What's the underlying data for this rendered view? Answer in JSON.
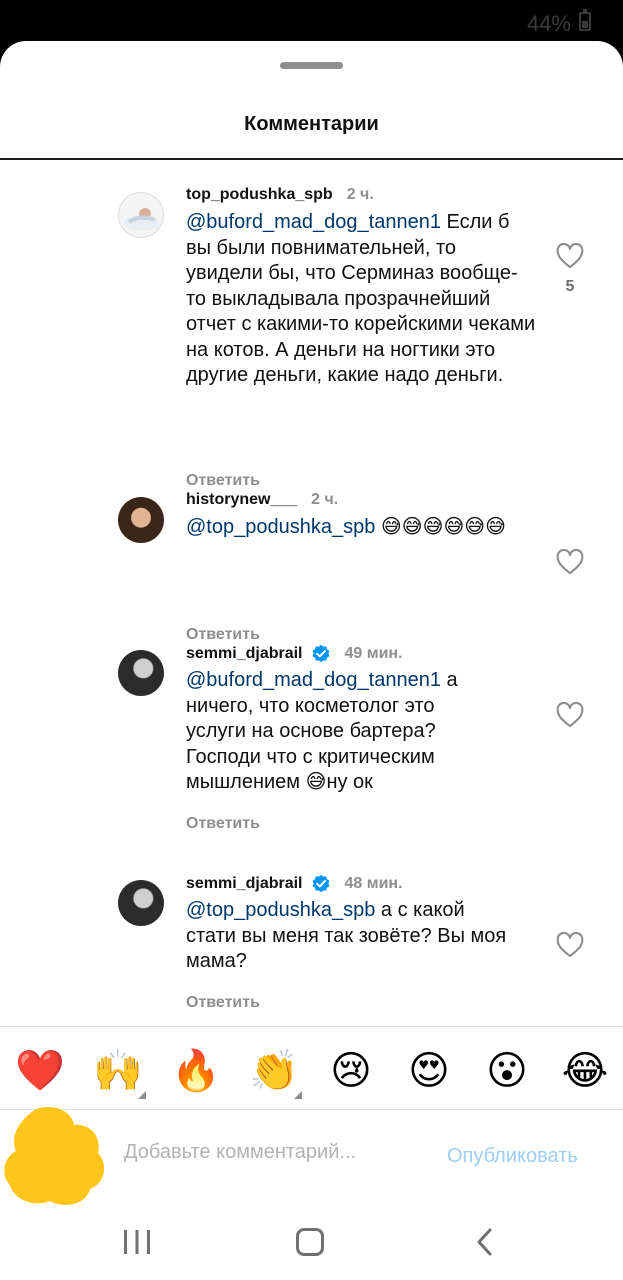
{
  "status_bar": {
    "battery": "44%"
  },
  "sheet": {
    "title": "Комментарии"
  },
  "comments": [
    {
      "author": "top_podushka_spb",
      "verified": false,
      "time": "2 ч.",
      "mention": "@buford_mad_dog_tannen1",
      "text": " Если б вы были повнимательней, то увидели бы, что Серминаз вообще-то выкладывала прозрачнейший отчет с какими-то корейскими чеками на котов. А деньги на ногтики это другие деньги, какие надо деньги.",
      "reply": "Ответить",
      "likes": "5"
    },
    {
      "author": "historynew___",
      "verified": false,
      "time": "2 ч.",
      "mention": "@top_podushka_spb",
      "text": " 😅😅😅😅😅😅",
      "reply": "Ответить"
    },
    {
      "author": "semmi_djabrail",
      "verified": true,
      "time": "49 мин.",
      "mention": "@buford_mad_dog_tannen1",
      "text": " а ничего, что косметолог это услуги на основе бартера? Господи что с критическим мышлением 😅ну ок",
      "reply": "Ответить"
    },
    {
      "author": "semmi_djabrail",
      "verified": true,
      "time": "48 мин.",
      "mention": "@top_podushka_spb",
      "text": " а с какой стати вы меня так зовёте? Вы моя мама?",
      "reply": "Ответить"
    }
  ],
  "quick_reactions": [
    "❤️",
    "🙌",
    "🔥",
    "👏",
    "😢",
    "😍",
    "😮",
    "😂"
  ],
  "composer": {
    "placeholder": "Добавьте комментарий...",
    "publish_label": "Опубликовать"
  },
  "colors": {
    "mention": "#00376b",
    "publish_disabled": "#9ccef6",
    "verified": "#0095f6",
    "scribble": "#ffc51a"
  }
}
